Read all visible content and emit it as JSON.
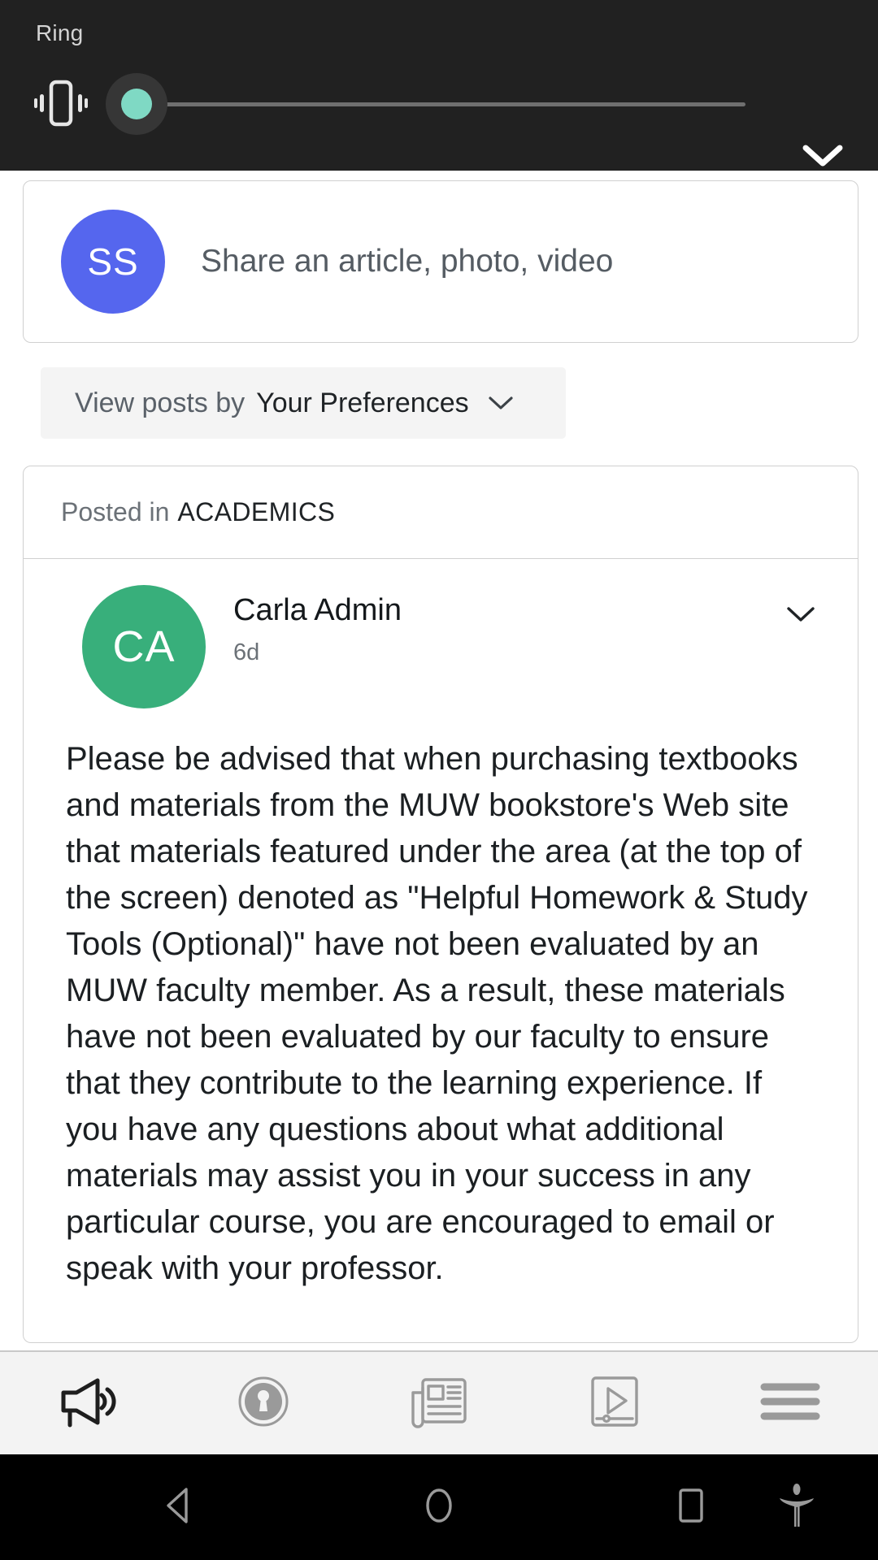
{
  "volume_panel": {
    "title": "Ring",
    "vibrate_icon": "vibrate-icon",
    "expand_icon": "chevron-down-icon",
    "slider": {
      "value": 4,
      "min": 0,
      "max": 100,
      "thumb_color": "#7fd9c4",
      "track_color": "#6f6f6f"
    },
    "background": "#212121"
  },
  "composer": {
    "avatar_initials": "SS",
    "avatar_color": "#5566ee",
    "placeholder": "Share an article, photo, video"
  },
  "filter": {
    "label": "View posts by",
    "value": "Your Preferences",
    "caret_icon": "chevron-down-icon"
  },
  "post": {
    "channel_prefix": "Posted in",
    "channel_name": "ACADEMICS",
    "author_initials": "CA",
    "author_avatar_color": "#38af7b",
    "author_name": "Carla Admin",
    "timestamp": "6d",
    "menu_icon": "chevron-down-icon",
    "body": "Please be advised that when purchasing textbooks and materials from the MUW bookstore's Web site that materials featured under the area (at the top of the screen) denoted as \"Helpful Homework & Study Tools (Optional)\" have not been evaluated by an MUW faculty member. As a result, these materials have not been evaluated by our faculty to ensure that they contribute to the learning experience. If you have any questions about what additional materials may assist you in your success in any particular course, you are encouraged to email or speak with your professor."
  },
  "app_nav": {
    "items": [
      {
        "name": "announcements",
        "icon": "megaphone-icon",
        "active": true
      },
      {
        "name": "privacy",
        "icon": "keyhole-icon",
        "active": false
      },
      {
        "name": "news",
        "icon": "newspaper-icon",
        "active": false
      },
      {
        "name": "videos",
        "icon": "video-player-icon",
        "active": false
      },
      {
        "name": "menu",
        "icon": "hamburger-menu-icon",
        "active": false
      }
    ],
    "background": "#f3f3f3"
  },
  "system_nav": {
    "background": "#000000",
    "buttons": [
      {
        "name": "back",
        "icon": "triangle-back-icon"
      },
      {
        "name": "home",
        "icon": "circle-home-icon"
      },
      {
        "name": "recents",
        "icon": "square-recents-icon"
      },
      {
        "name": "accessibility",
        "icon": "accessibility-person-icon"
      }
    ]
  }
}
